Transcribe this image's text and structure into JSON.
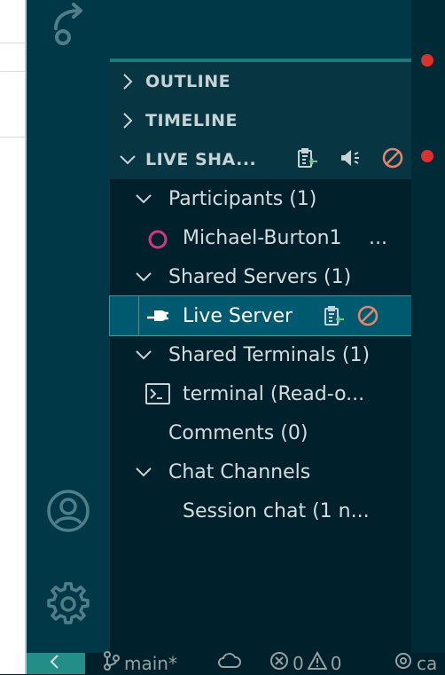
{
  "sections": {
    "outline": "OUTLINE",
    "timeline": "TIMELINE",
    "live_share": "LIVE SHA..."
  },
  "live_share": {
    "participants_label": "Participants (1)",
    "participant_name": "Michael-Burton1",
    "participant_more": "...",
    "shared_servers_label": "Shared Servers (1)",
    "server_name": "Live Server",
    "shared_terminals_label": "Shared Terminals (1)",
    "terminal_name": "terminal (Read-o...",
    "comments_label": "Comments (0)",
    "chat_channels_label": "Chat Channels",
    "session_chat": "Session chat (1 n..."
  },
  "status_bar": {
    "branch": "main*",
    "errors": "0",
    "warnings": "0",
    "extra": "ca"
  },
  "colors": {
    "accent": "#2aa198",
    "participant_ring": "#d33682",
    "stop_icon": "#e8836c",
    "breakpoint": "#dc322f"
  },
  "icons": [
    "live-share-icon",
    "account-icon",
    "settings-gear-icon",
    "chevron-right-icon",
    "chevron-down-icon",
    "copy-link-icon",
    "audio-icon",
    "stop-icon",
    "plug-icon",
    "terminal-icon",
    "remote-icon",
    "git-branch-icon",
    "cloud-icon",
    "error-icon",
    "warning-icon",
    "broadcast-icon"
  ]
}
